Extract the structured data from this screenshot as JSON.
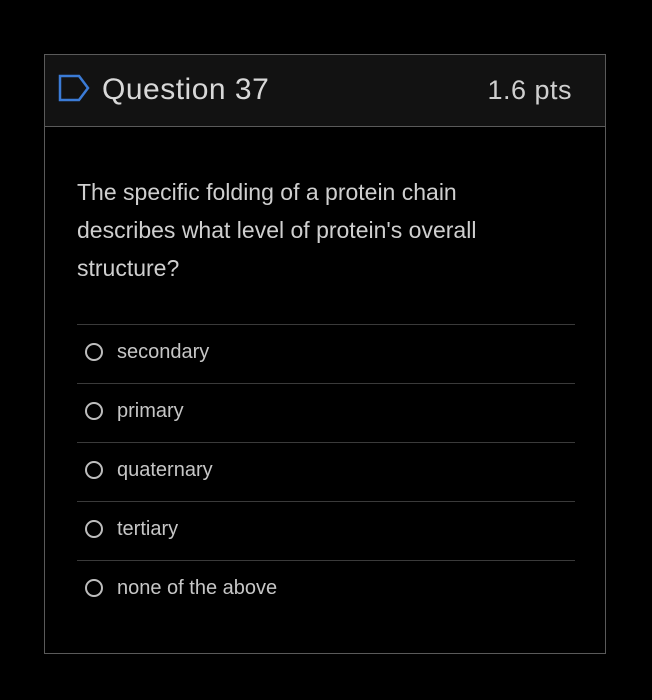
{
  "question": {
    "title": "Question 37",
    "points": "1.6 pts",
    "text": "The specific folding of a protein chain describes what level of protein's overall structure?",
    "flag_icon": "flag-outline-icon"
  },
  "answers": [
    {
      "label": "secondary"
    },
    {
      "label": "primary"
    },
    {
      "label": "quaternary"
    },
    {
      "label": "tertiary"
    },
    {
      "label": "none of the above"
    }
  ],
  "colors": {
    "background": "#000000",
    "header_bg": "#121212",
    "border": "#5a5a5a",
    "text": "#cfcfcf"
  }
}
